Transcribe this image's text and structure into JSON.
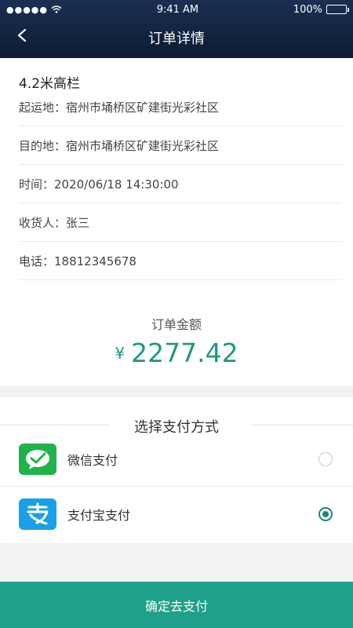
{
  "status_bar": {
    "signal": "●●●●●",
    "time": "9:41 AM",
    "battery": "100%"
  },
  "header": {
    "title": "订单详情"
  },
  "order": {
    "vehicle": "4.2米高栏",
    "origin": "起运地：宿州市埇桥区矿建街光彩社区",
    "destination": "目的地：宿州市埇桥区矿建街光彩社区",
    "time": "时间：2020/06/18 14:30:00",
    "consignee": "收货人：张三",
    "phone": "电话：18812345678"
  },
  "amount": {
    "label": "订单金额",
    "currency": "¥",
    "value": "2277.42"
  },
  "payment": {
    "title": "选择支付方式",
    "options": [
      {
        "name": "微信支付",
        "icon": "wechat-pay-icon",
        "selected": false
      },
      {
        "name": "支付宝支付",
        "icon": "alipay-icon",
        "selected": true
      }
    ]
  },
  "confirm_label": "确定去支付",
  "colors": {
    "header": "#14264a",
    "accent": "#1fa08a",
    "amount": "#1a9a86",
    "wechat": "#20b34a",
    "alipay": "#1aa0e8"
  }
}
